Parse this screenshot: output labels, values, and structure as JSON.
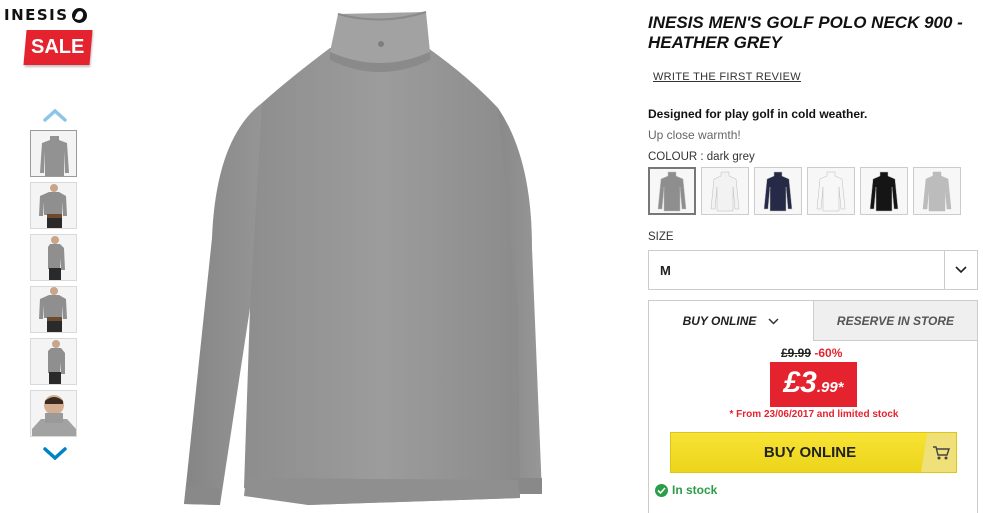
{
  "brand": {
    "name": "INESIS"
  },
  "badge": {
    "sale_label": "SALE"
  },
  "product": {
    "title": "INESIS MEN'S GOLF POLO NECK 900 - HEATHER GREY",
    "review_link": "WRITE THE FIRST REVIEW",
    "description": "Designed for play golf in cold weather.",
    "subtitle": "Up close warmth!"
  },
  "colour": {
    "label": "COLOUR : dark grey",
    "swatches": [
      {
        "color": "#8e8e8e",
        "selected": true
      },
      {
        "color": "#f2f2f2"
      },
      {
        "color": "#262a46"
      },
      {
        "color": "#f7f7f7"
      },
      {
        "color": "#151515"
      },
      {
        "color": "#bcbcbc"
      }
    ]
  },
  "size": {
    "label": "SIZE",
    "value": "M"
  },
  "tabs": {
    "online": "BUY ONLINE",
    "store": "RESERVE IN STORE"
  },
  "price": {
    "old": "£9.99",
    "discount": "-60%",
    "main": "£3",
    "decimals": ".99*",
    "note": "* From 23/06/2017 and limited stock"
  },
  "buy_button": {
    "label": "BUY ONLINE"
  },
  "stock": {
    "label": "In stock"
  },
  "colors": {
    "sale_red": "#e5232f",
    "buy_yellow": "#f3dd28",
    "stock_green": "#2a9d48",
    "arrow_blue": "#0082c3",
    "arrow_light": "#8cc4ea"
  },
  "thumbnails": [
    {
      "view": "front"
    },
    {
      "view": "model-front"
    },
    {
      "view": "model-side"
    },
    {
      "view": "model-front-2"
    },
    {
      "view": "model-side-2"
    },
    {
      "view": "collar-closeup"
    }
  ]
}
